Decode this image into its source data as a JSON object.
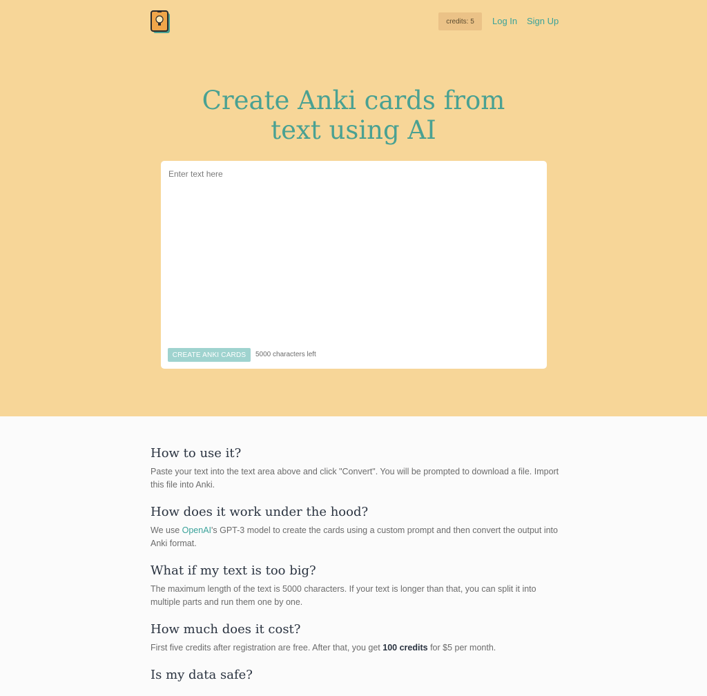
{
  "nav": {
    "credits": "credits: 5",
    "login": "Log In",
    "signup": "Sign Up"
  },
  "hero": {
    "title_line1": "Create Anki cards from",
    "title_line2": "text using AI",
    "input_placeholder": "Enter text here",
    "input_value": "",
    "create_button": "CREATE ANKI CARDS",
    "chars_left": "5000 characters left"
  },
  "faq": [
    {
      "question": "How to use it?",
      "answer": "Paste your text into the text area above and click \"Convert\". You will be prompted to download a file. Import this file into Anki."
    },
    {
      "question": "How does it work under the hood?",
      "answer_pre": "We use ",
      "answer_link": "OpenAI",
      "answer_post": "'s GPT-3 model to create the cards using a custom prompt and then convert the output into Anki format."
    },
    {
      "question": "What if my text is too big?",
      "answer": "The maximum length of the text is 5000 characters. If your text is longer than that, you can split it into multiple parts and run them one by one."
    },
    {
      "question": "How much does it cost?",
      "answer_pre": "First five credits after registration are free. After that, you get ",
      "answer_bold": "100 credits",
      "answer_post": " for $5 per month."
    },
    {
      "question": "Is my data safe?"
    }
  ],
  "colors": {
    "hero_bg": "#f7d698",
    "accent": "#4aa192",
    "button_bg": "#9fd3cf"
  }
}
